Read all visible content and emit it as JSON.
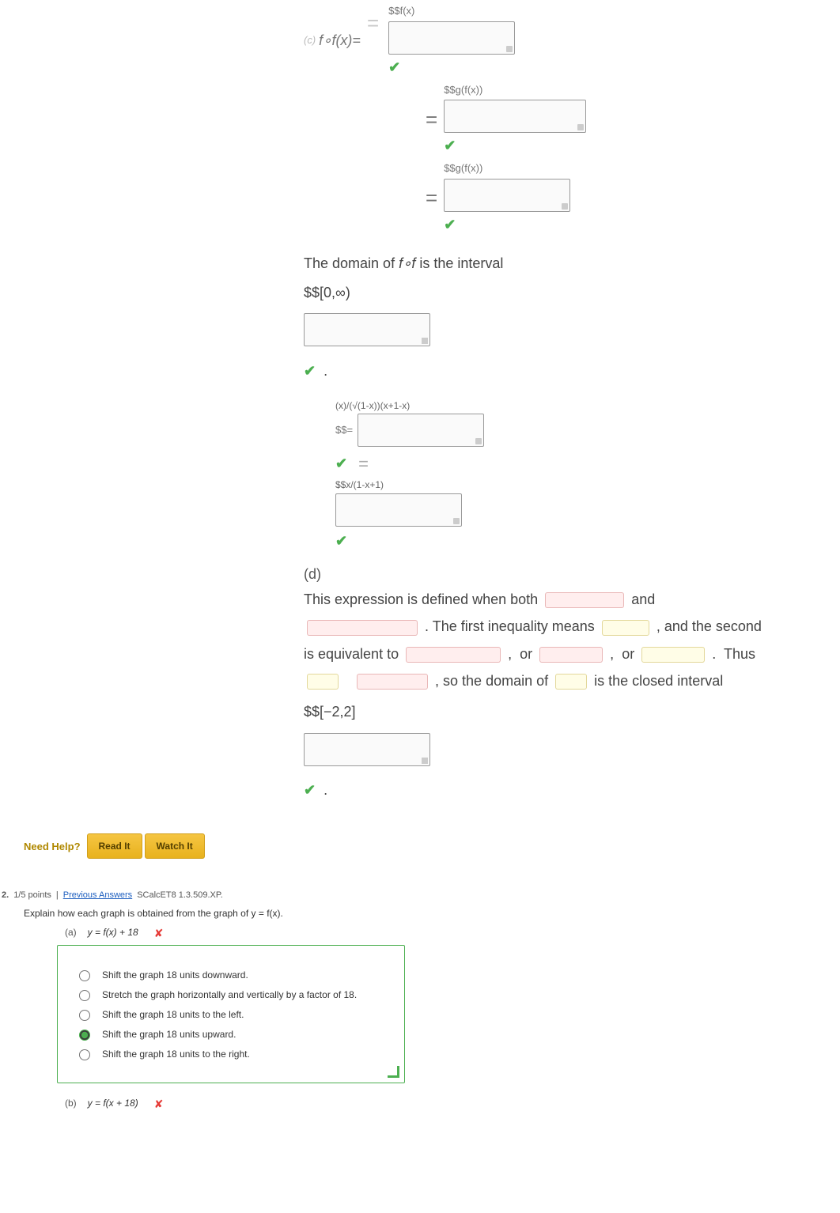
{
  "mathSection": {
    "topPref": "(c) f∘f(x)=",
    "fxPrefix": "$$f(x)",
    "fxEq": "=",
    "gxPrefix": "$$g(f(x))",
    "gxEq": "=",
    "gxPrefix2": "$$g(f(x))",
    "domainIntro": "The domain of ",
    "fof": "f∘f",
    "domainAfter": " is the interval",
    "interval1": "$$[0,∞)",
    "period1": ".",
    "indentBlock": {
      "line1a": "(x)/(√(1-x))(x+1-x)",
      "line1b": "$$=",
      "line2a": "$$x/(1-x+1)"
    },
    "partD": {
      "label": "(d)",
      "flow1": "This expression is defined when both ",
      "flowAnd": "and",
      "flow2a": ". The first inequality means ",
      "flow2b": ", and the second",
      "flow3a": "is equivalent to ",
      "flowOr1": "or",
      "flowOr2": "or",
      "flow4a": "Thus",
      "flow5a": ", so the domain of ",
      "flow5b": " is the closed interval",
      "interval2": "$$[−2,2]",
      "period2": "."
    }
  },
  "nav": {
    "needHelp": "Need Help?",
    "btn1": "Read It",
    "btn2": "Watch It"
  },
  "q2": {
    "scoreLabel": "1/5 points",
    "prevLink": "Previous Answers",
    "ref": "SCalcET8 1.3.509.XP.",
    "title": "Explain how each graph is obtained from the graph of y = f(x).",
    "subA": {
      "letter": "(a)",
      "eq": "y = f(x) + 18",
      "options": [
        "Shift the graph 18 units downward.",
        "Stretch the graph horizontally and vertically by a factor of 18.",
        "Shift the graph 18 units to the left.",
        "Shift the graph 18 units upward.",
        "Shift the graph 18 units to the right."
      ]
    },
    "subB": {
      "letter": "(b)",
      "eq": "y = f(x + 18)"
    }
  }
}
